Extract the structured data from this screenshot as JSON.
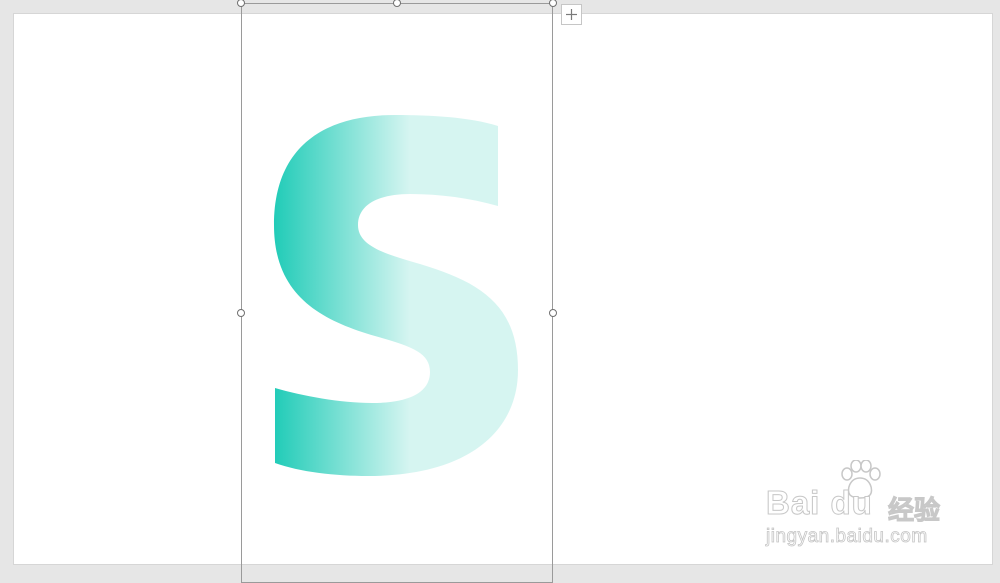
{
  "slide": {
    "glyph_text": "S",
    "gradient_colors": [
      "#22ccb8",
      "#d6f5f1"
    ]
  },
  "selection": {
    "layout_options_icon": "plus-icon"
  },
  "watermark": {
    "brand": "Bai du",
    "brand_cn": "经验",
    "url": "jingyan.baidu.com"
  },
  "colors": {
    "workspace": "#e6e6e6",
    "slide_background": "#ffffff",
    "selection_border": "#9a9a9a"
  }
}
